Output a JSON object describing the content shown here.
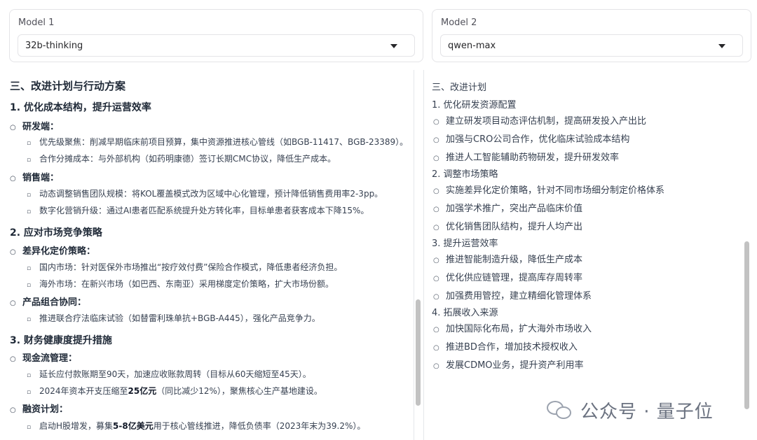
{
  "model1": {
    "label": "Model 1",
    "value": "32b-thinking"
  },
  "model2": {
    "label": "Model 2",
    "value": "qwen-max"
  },
  "left": {
    "heading": "三、改进计划与行动方案",
    "s1": {
      "title": "1. 优化成本结构，提升运营效率",
      "b1": "研发端",
      "b1_items": [
        "优先级聚焦：削减早期临床前项目预算，集中资源推进核心管线（如BGB-11417、BGB-23389）。",
        "合作分摊成本：与外部机构（如药明康德）签订长期CMC协议，降低生产成本。"
      ],
      "b2": "销售端",
      "b2_items": [
        "动态调整销售团队规模：将KOL覆盖模式改为区域中心化管理，预计降低销售费用率2-3pp。",
        "数字化营销升级：通过AI患者匹配系统提升处方转化率，目标单患者获客成本下降15%。"
      ]
    },
    "s2": {
      "title": "2. 应对市场竞争策略",
      "b1": "差异化定价策略",
      "b1_items": [
        "国内市场：针对医保外市场推出“按疗效付费”保险合作模式，降低患者经济负担。",
        "海外市场：在新兴市场（如巴西、东南亚）采用梯度定价策略，扩大市场份额。"
      ],
      "b2": "产品组合协同",
      "b2_items": [
        "推进联合疗法临床试验（如替雷利珠单抗+BGB-A445），强化产品竞争力。"
      ]
    },
    "s3": {
      "title": "3. 财务健康度提升措施",
      "b1": "现金流管理",
      "b1_items": [
        "延长应付款账期至90天，加速应收账款周转（目标从60天缩短至45天）。"
      ],
      "b1_item2_pre": "2024年资本开支压缩至",
      "b1_item2_strong": "25亿元",
      "b1_item2_post": "（同比减少12%），聚焦核心生产基地建设。",
      "b2": "融资计划",
      "b2_item_pre": "启动H股增发，募集",
      "b2_item_strong": "5-8亿美元",
      "b2_item_post": "用于核心管线推进，降低负债率（2023年末为39.2%）。"
    }
  },
  "right": {
    "heading": "三、改进计划",
    "sections": [
      {
        "title": "1. 优化研发资源配置",
        "items": [
          "建立研发项目动态评估机制，提高研发投入产出比",
          "加强与CRO公司合作，优化临床试验成本结构",
          "推进人工智能辅助药物研发，提升研发效率"
        ]
      },
      {
        "title": "2. 调整市场策略",
        "items": [
          "实施差异化定价策略，针对不同市场细分制定价格体系",
          "加强学术推广，突出产品临床价值",
          "优化销售团队结构，提升人均产出"
        ]
      },
      {
        "title": "3. 提升运营效率",
        "items": [
          "推进智能制造升级，降低生产成本",
          "优化供应链管理，提高库存周转率",
          "加强费用管控，建立精细化管理体系"
        ]
      },
      {
        "title": "4. 拓展收入来源",
        "items": [
          "加快国际化布局，扩大海外市场收入",
          "推进BD合作，增加技术授权收入",
          "发展CDMO业务，提升资产利用率"
        ]
      }
    ]
  },
  "watermark": {
    "text": "公众号 · 量子位"
  }
}
